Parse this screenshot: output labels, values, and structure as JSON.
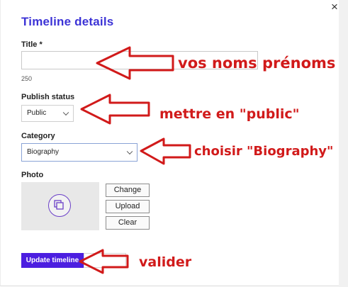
{
  "dialog": {
    "title": "Timeline details",
    "close_glyph": "×",
    "close_icon": "close-icon"
  },
  "form": {
    "title_label": "Title *",
    "title_value": "",
    "title_placeholder": "",
    "title_char_count": "250",
    "publish_label": "Publish status",
    "publish_value": "Public",
    "category_label": "Category",
    "category_value": "Biography",
    "photo_label": "Photo",
    "photo_icon": "image-placeholder-icon",
    "photo_buttons": [
      "Change",
      "Upload",
      "Clear"
    ],
    "submit_label": "Update timeline"
  },
  "annotations": [
    "vos noms prénoms",
    "mettre en \"public\"",
    "choisir \"Biography\"",
    "valider"
  ],
  "colors": {
    "title": "#3c33d6",
    "primary_button": "#4c1ee0",
    "annotation": "#d11a1a",
    "photo_icon": "#6a3fc7"
  }
}
